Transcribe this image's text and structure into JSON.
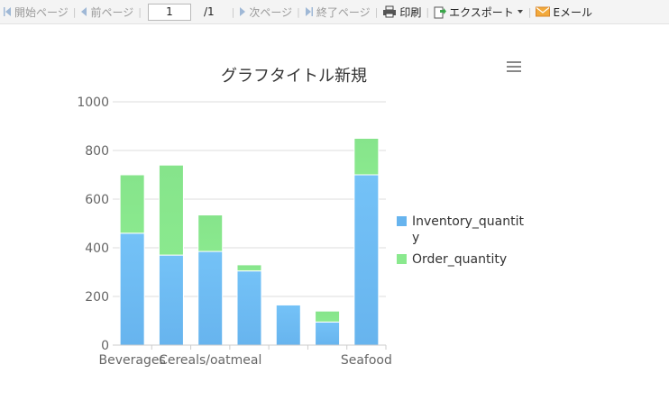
{
  "toolbar": {
    "first_page": "開始ページ",
    "prev_page": "前ページ",
    "page_value": "1",
    "page_total": "/1",
    "next_page": "次ページ",
    "last_page": "終了ページ",
    "print": "印刷",
    "export": "エクスポート",
    "email": "Eメール"
  },
  "colors": {
    "inventory": "#67b4ee",
    "order": "#8ae98e",
    "grid": "#dcdcdc",
    "axis_text": "#666666"
  },
  "chart_data": {
    "type": "bar",
    "stacked": true,
    "title": "グラフタイトル新規",
    "categories": [
      "Beverages",
      "",
      "Cereals/oatmeal",
      "",
      "",
      "",
      "Seafood"
    ],
    "series": [
      {
        "name": "Inventory_quantity",
        "values": [
          460,
          370,
          385,
          305,
          165,
          95,
          700
        ]
      },
      {
        "name": "Order_quantity",
        "values": [
          240,
          370,
          150,
          25,
          0,
          45,
          150
        ]
      }
    ],
    "ylim": [
      0,
      1000
    ],
    "yticks": [
      "0",
      "200",
      "400",
      "600",
      "800",
      "1000"
    ],
    "grid": true,
    "legend_position": "right"
  }
}
